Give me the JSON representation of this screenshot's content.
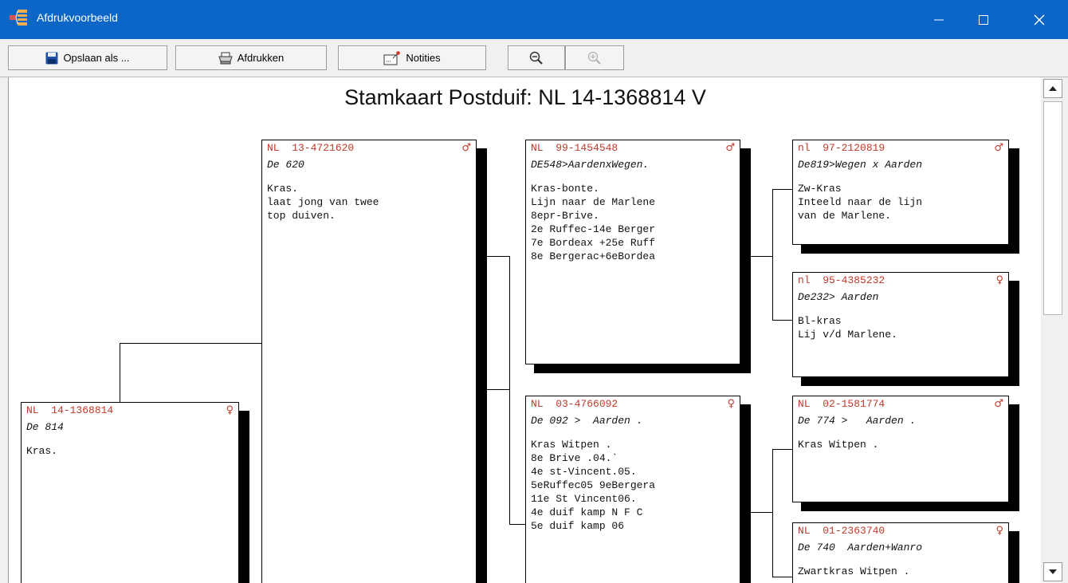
{
  "window": {
    "title": "Afdrukvoorbeeld"
  },
  "toolbar": {
    "save_label": "Opslaan als ...",
    "print_label": "Afdrukken",
    "notes_label": "Notities"
  },
  "document": {
    "title": "Stamkaart Postduif: NL  14-1368814 V"
  },
  "cards": {
    "subject": {
      "ring": "NL  14-1368814",
      "sex": "♀",
      "name": "De 814",
      "notes": [
        "Kras."
      ]
    },
    "father": {
      "ring": "NL  13-4721620",
      "sex": "♂",
      "name": "De 620",
      "notes": [
        "Kras.",
        "laat jong van twee",
        "top duiven."
      ]
    },
    "ff": {
      "ring": "NL  99-1454548",
      "sex": "♂",
      "name": "DE548>AardenxWegen.",
      "notes": [
        "Kras-bonte.",
        "Lijn naar de Marlene",
        "8epr-Brive.",
        "2e Ruffec-14e Berger",
        "7e Bordeax +25e Ruff",
        "8e Bergerac+6eBordea"
      ]
    },
    "fm": {
      "ring": "NL  03-4766092",
      "sex": "♀",
      "name": "De 092 >  Aarden .",
      "notes": [
        "Kras Witpen .",
        "8e Brive .04.`",
        "4e st-Vincent.05.",
        "5eRuffec05 9eBergera",
        "11e St Vincent06.",
        "4e duif kamp N F C",
        "5e duif kamp 06"
      ]
    },
    "fff": {
      "ring": "nl  97-2120819",
      "sex": "♂",
      "name": "De819>Wegen x Aarden",
      "notes": [
        "Zw-Kras",
        "Inteeld naar de lijn",
        "van de Marlene."
      ]
    },
    "ffm": {
      "ring": "nl  95-4385232",
      "sex": "♀",
      "name": "De232> Aarden",
      "notes": [
        "Bl-kras",
        "Lij v/d Marlene."
      ]
    },
    "fmf": {
      "ring": "NL  02-1581774",
      "sex": "♂",
      "name": "De 774 >   Aarden .",
      "notes": [
        "Kras Witpen ."
      ]
    },
    "fmm": {
      "ring": "NL  01-2363740",
      "sex": "♀",
      "name": "De 740  Aarden+Wanro",
      "notes": [
        "Zwartkras Witpen ."
      ]
    }
  }
}
